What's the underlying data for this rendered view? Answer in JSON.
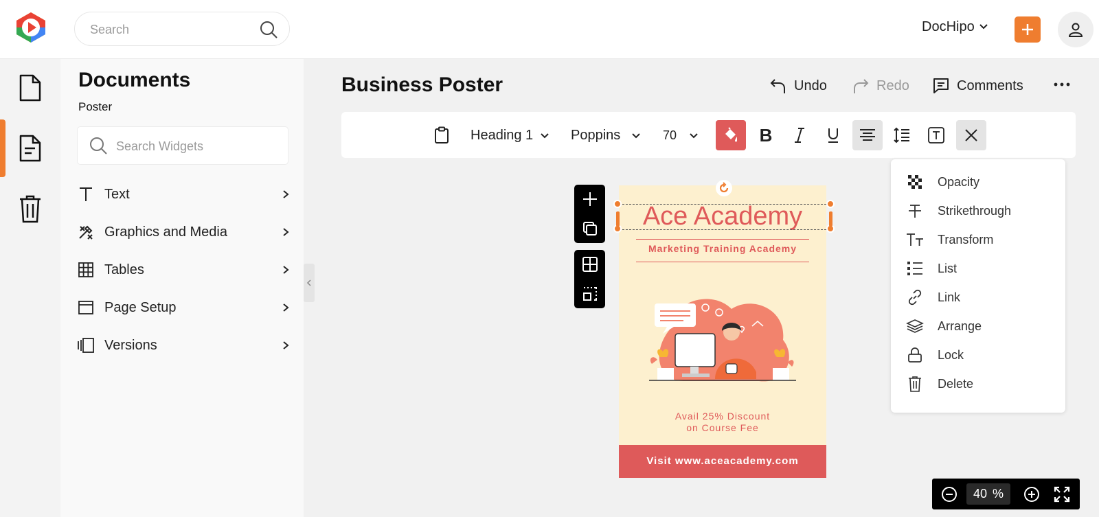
{
  "header": {
    "search_placeholder": "Search",
    "workspace_name": "DocHipo",
    "colors": {
      "accent": "#ef7d2f"
    }
  },
  "rail": {
    "items": [
      {
        "icon": "document-icon",
        "active": false
      },
      {
        "icon": "file-text-icon",
        "active": true
      },
      {
        "icon": "trash-icon",
        "active": false
      }
    ]
  },
  "panel": {
    "title": "Documents",
    "subtitle": "Poster",
    "search_placeholder": "Search Widgets",
    "items": [
      {
        "label": "Text",
        "icon": "text-icon"
      },
      {
        "label": "Graphics and Media",
        "icon": "graphics-icon"
      },
      {
        "label": "Tables",
        "icon": "table-icon"
      },
      {
        "label": "Page Setup",
        "icon": "page-setup-icon"
      },
      {
        "label": "Versions",
        "icon": "versions-icon"
      }
    ]
  },
  "editor": {
    "doc_title": "Business Poster",
    "undo_label": "Undo",
    "redo_label": "Redo",
    "comments_label": "Comments"
  },
  "toolbar": {
    "text_style": "Heading 1",
    "font": "Poppins",
    "size": "70"
  },
  "poster": {
    "title": "Ace Academy",
    "subtitle": "Marketing Training Academy",
    "offer_line1": "Avail 25% Discount",
    "offer_line2": "on Course Fee",
    "footer": "Visit www.aceacademy.com",
    "colors": {
      "background": "#fdf0cf",
      "primary": "#df5a5a"
    }
  },
  "dropdown": {
    "items": [
      {
        "label": "Opacity",
        "icon": "opacity-icon"
      },
      {
        "label": "Strikethrough",
        "icon": "strikethrough-icon"
      },
      {
        "label": "Transform",
        "icon": "transform-icon"
      },
      {
        "label": "List",
        "icon": "list-icon"
      },
      {
        "label": "Link",
        "icon": "link-icon"
      },
      {
        "label": "Arrange",
        "icon": "arrange-icon"
      },
      {
        "label": "Lock",
        "icon": "lock-icon"
      },
      {
        "label": "Delete",
        "icon": "trash-icon"
      }
    ]
  },
  "zoom": {
    "value": "40",
    "unit": "%"
  }
}
